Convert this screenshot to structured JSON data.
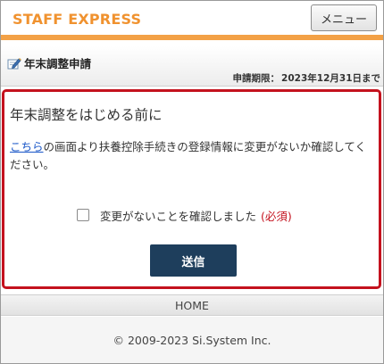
{
  "header": {
    "logo": "STAFF EXPRESS",
    "menu_label": "メニュー"
  },
  "page": {
    "title": "年末調整申請",
    "deadline_label": "申請期限：",
    "deadline_value": "2023年12月31日まで"
  },
  "notice": {
    "heading": "年末調整をはじめる前に",
    "link_text": "こちら",
    "body_text": "の画面より扶養控除手続きの登録情報に変更がないか確認してください。",
    "confirm_label": "変更がないことを確認しました",
    "required_label": "(必須)",
    "confirm_checked": false,
    "submit_label": "送信"
  },
  "nav": {
    "home_label": "HOME"
  },
  "footer": {
    "copyright": "© 2009-2023 Si.System Inc."
  },
  "colors": {
    "brand_orange": "#f0922f",
    "alert_red": "#c4121e",
    "submit_navy": "#1e3e5c",
    "link_blue": "#1a57c8"
  },
  "icons": {
    "title_icon": "pencil-edit-icon"
  }
}
